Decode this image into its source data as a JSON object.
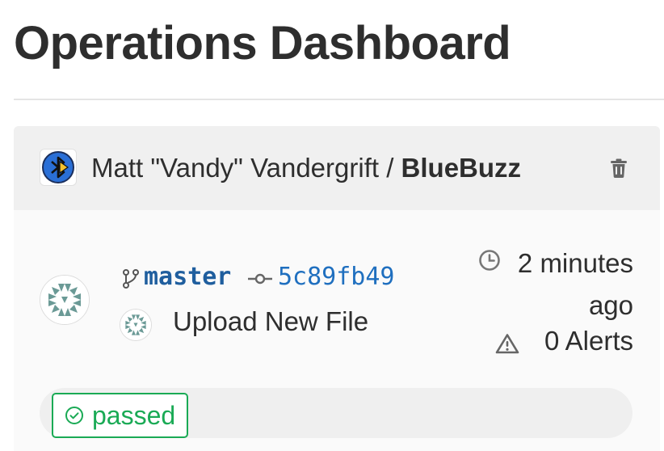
{
  "page": {
    "title": "Operations Dashboard"
  },
  "project": {
    "owner_display": "Matt \"Vandy\" Vandergrift / ",
    "repo_name": "BlueBuzz",
    "avatar_icon": "bluetooth-icon",
    "remove_icon": "trash-icon"
  },
  "deployment": {
    "branch": "master",
    "commit_sha": "5c89fb49",
    "commit_title": "Upload New File",
    "time_ago": "2 minutes ago",
    "alerts": "0 Alerts",
    "status": "passed"
  },
  "colors": {
    "status_success": "#1aaa55",
    "link": "#1f6fbf",
    "header_bg": "#f0f0f0",
    "card_bg": "#fafafa"
  }
}
